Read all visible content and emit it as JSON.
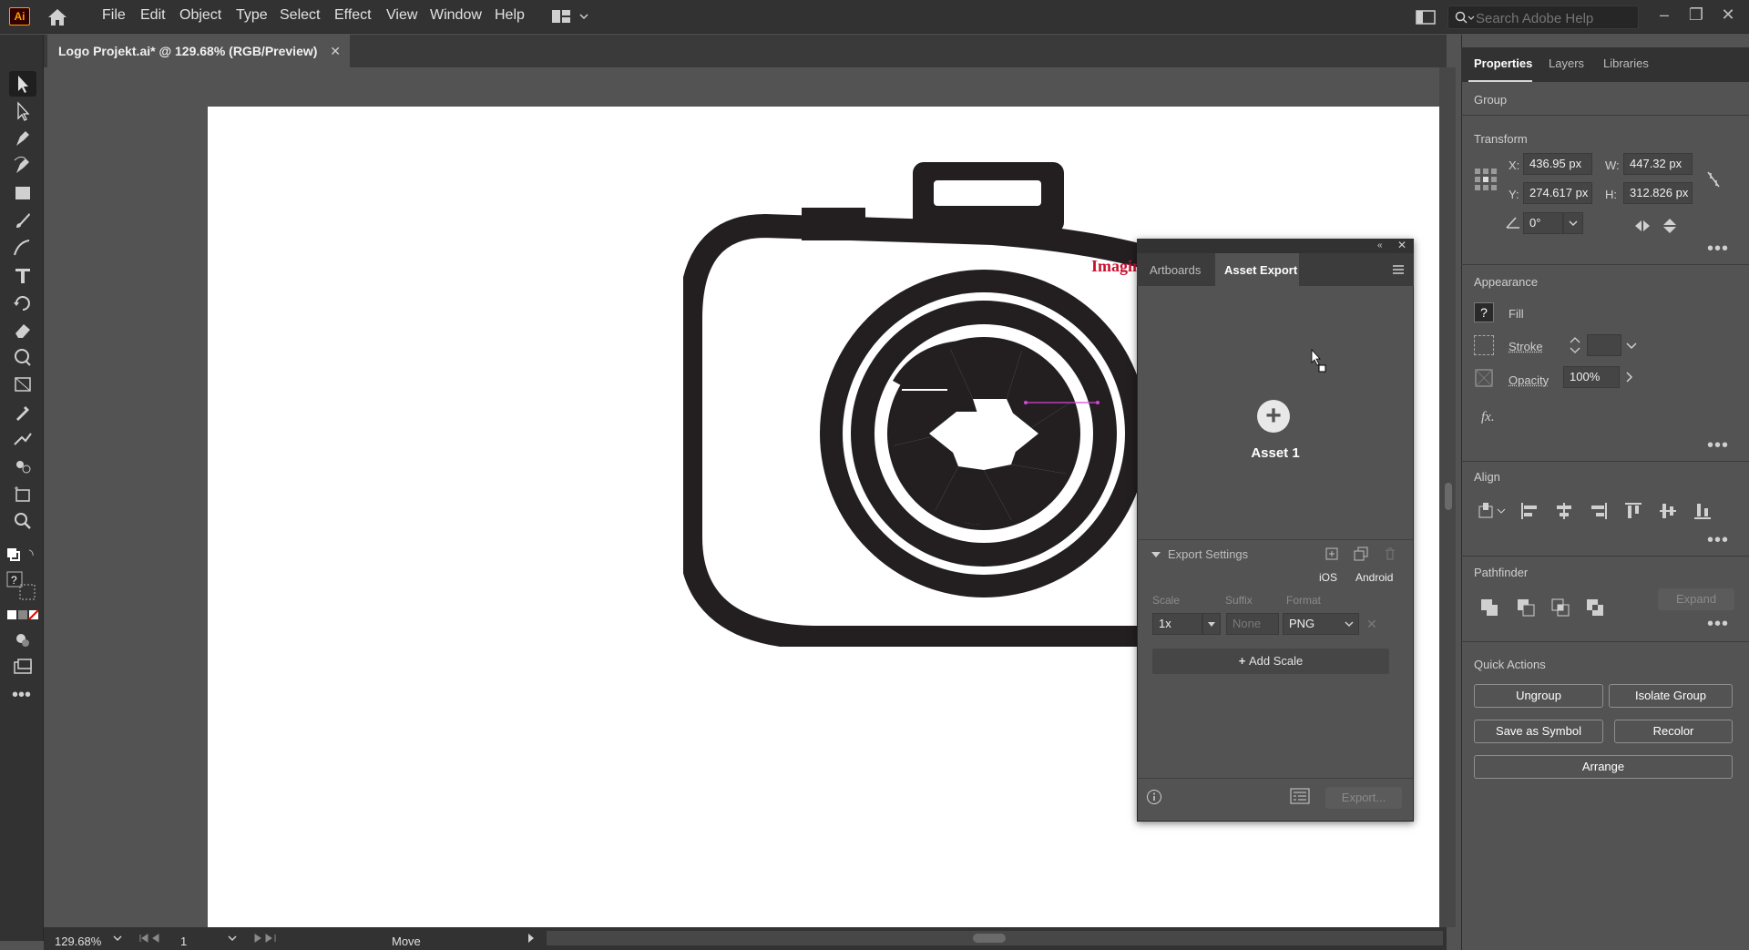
{
  "app": {
    "logo_text": "Ai"
  },
  "menu": {
    "items": [
      "File",
      "Edit",
      "Object",
      "Type",
      "Select",
      "Effect",
      "View",
      "Window",
      "Help"
    ]
  },
  "search": {
    "placeholder": "Search Adobe Help"
  },
  "document": {
    "tab_title": "Logo Projekt.ai* @ 129.68% (RGB/Preview)",
    "close": "✕"
  },
  "artwork": {
    "brand_text": "Imagine"
  },
  "status": {
    "zoom": "129.68%",
    "artboard": "1",
    "tool_status": "Move"
  },
  "right_panel": {
    "tabs": [
      "Properties",
      "Layers",
      "Libraries"
    ],
    "selection_type": "Group",
    "transform": {
      "title": "Transform",
      "x_label": "X:",
      "x": "436.95 px",
      "y_label": "Y:",
      "y": "274.617 px",
      "w_label": "W:",
      "w": "447.32 px",
      "h_label": "H:",
      "h": "312.826 px",
      "angle": "0°"
    },
    "appearance": {
      "title": "Appearance",
      "fill_label": "Fill",
      "stroke_label": "Stroke",
      "opacity_label": "Opacity",
      "opacity": "100%",
      "fx": "fx."
    },
    "align": {
      "title": "Align"
    },
    "pathfinder": {
      "title": "Pathfinder",
      "expand": "Expand"
    },
    "quick_actions": {
      "title": "Quick Actions",
      "ungroup": "Ungroup",
      "isolate": "Isolate Group",
      "save_symbol": "Save as Symbol",
      "recolor": "Recolor",
      "arrange": "Arrange"
    }
  },
  "asset_export": {
    "tabs": [
      "Artboards",
      "Asset Export"
    ],
    "asset_name": "Asset 1",
    "export_settings": "Export Settings",
    "ios": "iOS",
    "android": "Android",
    "scale_label": "Scale",
    "suffix_label": "Suffix",
    "format_label": "Format",
    "scale": "1x",
    "suffix_placeholder": "None",
    "format": "PNG",
    "add_scale": "Add Scale",
    "export": "Export..."
  },
  "colors": {
    "accent_ai": "#ff9a00",
    "brand_red": "#c8102e",
    "ink": "#231f20",
    "selection": "#d645d6"
  }
}
